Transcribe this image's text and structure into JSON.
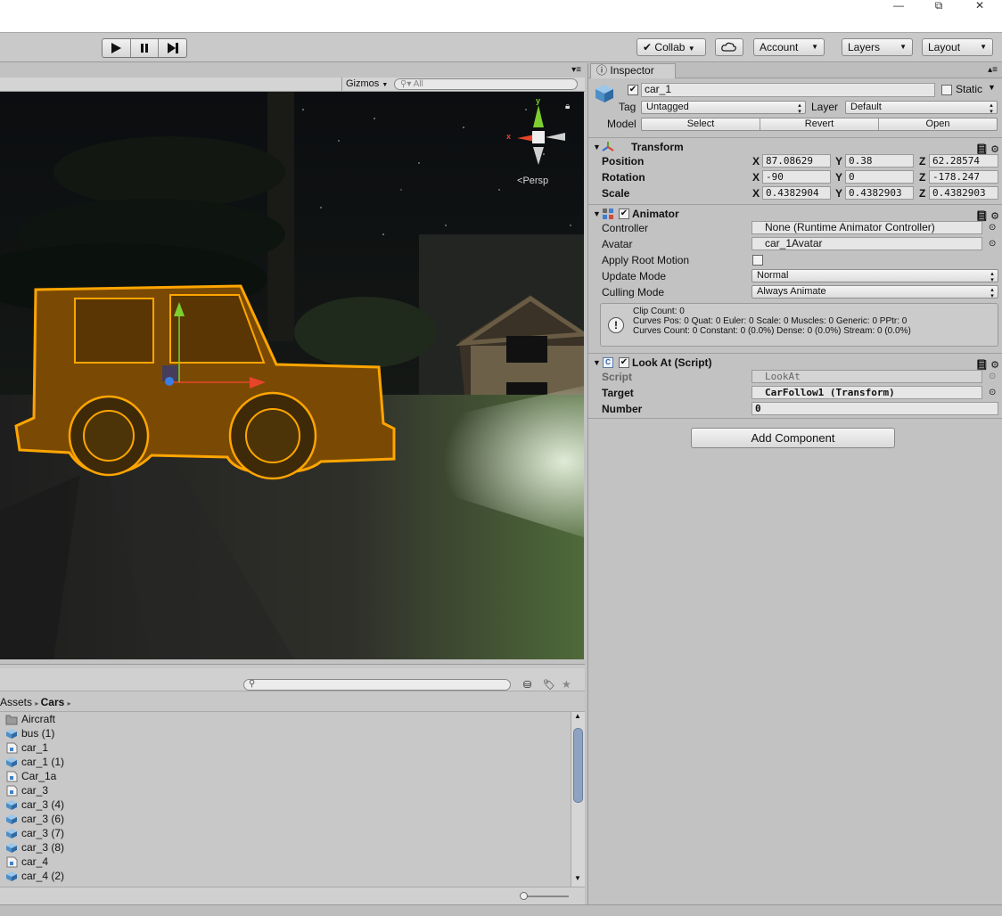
{
  "window": {
    "minimize": "—",
    "restore": "⧉",
    "close": "✕"
  },
  "toolbar": {
    "collab": "Collab",
    "account": "Account",
    "layers": "Layers",
    "layout": "Layout"
  },
  "scene": {
    "gizmos": "Gizmos",
    "search_placeholder": "All",
    "persp": "Persp",
    "axis_x": "x",
    "axis_y": "y"
  },
  "project": {
    "breadcrumb": [
      "Assets",
      "Cars"
    ],
    "assets": [
      {
        "name": "Aircraft",
        "type": "folder"
      },
      {
        "name": "bus (1)",
        "type": "prefab"
      },
      {
        "name": "car_1",
        "type": "model"
      },
      {
        "name": "car_1 (1)",
        "type": "prefab"
      },
      {
        "name": "Car_1a",
        "type": "model"
      },
      {
        "name": "car_3",
        "type": "model"
      },
      {
        "name": "car_3 (4)",
        "type": "prefab"
      },
      {
        "name": "car_3 (6)",
        "type": "prefab"
      },
      {
        "name": "car_3 (7)",
        "type": "prefab"
      },
      {
        "name": "car_3 (8)",
        "type": "prefab"
      },
      {
        "name": "car_4",
        "type": "model"
      },
      {
        "name": "car_4 (2)",
        "type": "prefab"
      }
    ]
  },
  "inspector": {
    "tab": "Inspector",
    "object_name": "car_1",
    "static_label": "Static",
    "tag_label": "Tag",
    "tag_value": "Untagged",
    "layer_label": "Layer",
    "layer_value": "Default",
    "model_label": "Model",
    "model_select": "Select",
    "model_revert": "Revert",
    "model_open": "Open",
    "transform": {
      "title": "Transform",
      "position_label": "Position",
      "rotation_label": "Rotation",
      "scale_label": "Scale",
      "x": "X",
      "y": "Y",
      "z": "Z",
      "position": [
        "87.08629",
        "0.38",
        "62.28574"
      ],
      "rotation": [
        "-90",
        "0",
        "-178.247"
      ],
      "scale": [
        "0.4382904",
        "0.4382903",
        "0.4382903"
      ]
    },
    "animator": {
      "title": "Animator",
      "controller_label": "Controller",
      "controller_value": "None (Runtime Animator Controller)",
      "avatar_label": "Avatar",
      "avatar_value": "car_1Avatar",
      "root_motion_label": "Apply Root Motion",
      "update_mode_label": "Update Mode",
      "update_mode_value": "Normal",
      "culling_mode_label": "Culling Mode",
      "culling_mode_value": "Always Animate",
      "info_lines": [
        "Clip Count: 0",
        "Curves Pos: 0 Quat: 0 Euler: 0 Scale: 0 Muscles: 0 Generic: 0 PPtr: 0",
        "Curves Count: 0 Constant: 0 (0.0%) Dense: 0 (0.0%) Stream: 0 (0.0%)"
      ]
    },
    "lookat": {
      "title": "Look At (Script)",
      "script_label": "Script",
      "script_value": "LookAt",
      "target_label": "Target",
      "target_value": "CarFollow1 (Transform)",
      "number_label": "Number",
      "number_value": "0"
    },
    "add_component": "Add Component"
  },
  "colors": {
    "selection_outline": "#ffa500",
    "car_body": "#7a4a05",
    "gizmo_x": "#e8442a",
    "gizmo_y": "#7ccf2f",
    "gizmo_z": "#3b7de0"
  }
}
